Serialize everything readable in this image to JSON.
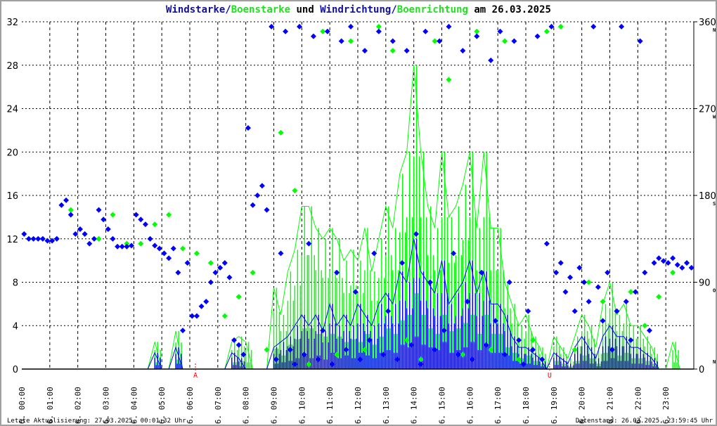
{
  "title": {
    "part1": "Windstarke/",
    "part2": "Boenstarke",
    "part3": " und ",
    "part4": "Windrichtung/",
    "part5": "Boenrichtung",
    "part6": " am 26.03.2025"
  },
  "footer": {
    "left": "Letzte Aktualisierung: 27.03.2025, 00:01:32 Uhr",
    "right": "Datenstand: 26.03.2025, 23:59:45 Uhr"
  },
  "colors": {
    "wind": "#0000ff",
    "gust": "#00ff00",
    "grid": "#000000",
    "marker": "#ff0000"
  },
  "chart_data": {
    "type": "line",
    "title": "Windstarke/Boenstarke und Windrichtung/Boenrichtung am 26.03.2025",
    "xlabel": "",
    "ylabel": "",
    "xlim_hours": [
      0,
      24
    ],
    "ylim": [
      0,
      32
    ],
    "yticks": [
      0,
      4,
      8,
      12,
      16,
      20,
      24,
      28,
      32
    ],
    "y2lim": [
      0,
      360
    ],
    "y2ticks": [
      {
        "v": 0,
        "l": "0",
        "c": "N"
      },
      {
        "v": 90,
        "l": "90",
        "c": "O"
      },
      {
        "v": 180,
        "l": "180",
        "c": "S"
      },
      {
        "v": 270,
        "l": "270",
        "c": "W"
      },
      {
        "v": 360,
        "l": "360",
        "c": "N"
      }
    ],
    "xticks": [
      "26.  00:00",
      "26.  01:00",
      "26.  02:00",
      "26.  03:00",
      "26.  04:00",
      "26.  05:00",
      "26.  06:00",
      "26.  07:00",
      "26.  08:00",
      "26.  09:00",
      "26.  10:00",
      "26.  11:00",
      "26.  12:00",
      "26.  13:00",
      "26.  14:00",
      "26.  15:00",
      "26.  16:00",
      "26.  17:00",
      "26.  18:00",
      "26.  19:00",
      "26.  20:00",
      "26.  21:00",
      "26.  22:00",
      "26.  23:00"
    ],
    "markers": [
      {
        "label": "A",
        "hour": 6.2
      },
      {
        "label": "U",
        "hour": 18.85
      }
    ],
    "speed_interval_min": 15,
    "series": [
      {
        "name": "Boenstarke",
        "axis": "left",
        "values": [
          0,
          0,
          0,
          0,
          0,
          0,
          0,
          0,
          0,
          0,
          0,
          0,
          0,
          0,
          0,
          0,
          0,
          0,
          0,
          2.5,
          0,
          0,
          3.5,
          0,
          0,
          0,
          0,
          0,
          0,
          0,
          2.5,
          3,
          2.5,
          0,
          0,
          0,
          7.5,
          5,
          9,
          11,
          15,
          15,
          13,
          12,
          13,
          12,
          10,
          11,
          10,
          13,
          9,
          12,
          15,
          13,
          18,
          20,
          28,
          20,
          15,
          13,
          20,
          14,
          15,
          17,
          20,
          13,
          20,
          13,
          13,
          8,
          6,
          4,
          5,
          3,
          2,
          0,
          3,
          2,
          1,
          3,
          5,
          4,
          2,
          6,
          8,
          5,
          6,
          4,
          4,
          3,
          2,
          0,
          0,
          2.5,
          0,
          0
        ]
      },
      {
        "name": "Windstarke",
        "axis": "left",
        "values": [
          0,
          0,
          0,
          0,
          0,
          0,
          0,
          0,
          0,
          0,
          0,
          0,
          0,
          0,
          0,
          0,
          0,
          0,
          0,
          1.5,
          0,
          0,
          2,
          0,
          0,
          0,
          0,
          0,
          0,
          0,
          1.5,
          1,
          0,
          0,
          0,
          0,
          2,
          2.5,
          3,
          4,
          5,
          4,
          5,
          3.5,
          6,
          4,
          5,
          4,
          6,
          5,
          4,
          6,
          7,
          6,
          9,
          8,
          12,
          9,
          8,
          7,
          10,
          6,
          7,
          8,
          10,
          7,
          9,
          6,
          6,
          5,
          3,
          2,
          2,
          1.5,
          1,
          0,
          1.5,
          1,
          0.5,
          2,
          3,
          2,
          1,
          3,
          4,
          3,
          3,
          2,
          2,
          1.5,
          1,
          0,
          0,
          0,
          0,
          0
        ]
      },
      {
        "name": "Windrichtung",
        "axis": "right",
        "interval_min": 10,
        "values": [
          140,
          135,
          135,
          135,
          135,
          133,
          133,
          135,
          170,
          175,
          160,
          140,
          145,
          140,
          130,
          135,
          165,
          155,
          145,
          135,
          127,
          127,
          127,
          128,
          160,
          155,
          150,
          135,
          128,
          125,
          120,
          115,
          125,
          100,
          40,
          110,
          55,
          55,
          65,
          70,
          90,
          100,
          105,
          110,
          95,
          30,
          25,
          15,
          250,
          170,
          180,
          190,
          165,
          355,
          10,
          120,
          350,
          20,
          5,
          355,
          15,
          130,
          345,
          10,
          40,
          350,
          5,
          100,
          340,
          20,
          355,
          80,
          10,
          330,
          30,
          120,
          350,
          15,
          60,
          340,
          10,
          110,
          330,
          25,
          140,
          5,
          350,
          90,
          20,
          340,
          40,
          355,
          120,
          15,
          330,
          70,
          10,
          345,
          100,
          25,
          320,
          50,
          350,
          15,
          90,
          340,
          30,
          5,
          60,
          20,
          345,
          10,
          130,
          355,
          100,
          110,
          80,
          95,
          60,
          105,
          90,
          70,
          355,
          85,
          50,
          100,
          20,
          60,
          355,
          70,
          30,
          80,
          340,
          100,
          40,
          110,
          115,
          112,
          110,
          115,
          108,
          105,
          110,
          105
        ]
      },
      {
        "name": "Boenrichtung",
        "axis": "right",
        "interval_min": 30,
        "values": [
          135,
          135,
          135,
          165,
          140,
          135,
          160,
          130,
          130,
          150,
          160,
          125,
          120,
          110,
          55,
          75,
          100,
          20,
          245,
          185,
          5,
          350,
          15,
          340,
          20,
          355,
          330,
          30,
          10,
          340,
          300,
          15,
          350,
          20,
          340,
          10,
          30,
          350,
          355,
          20,
          90,
          70,
          60,
          80,
          45,
          75,
          100,
          110
        ]
      }
    ]
  }
}
